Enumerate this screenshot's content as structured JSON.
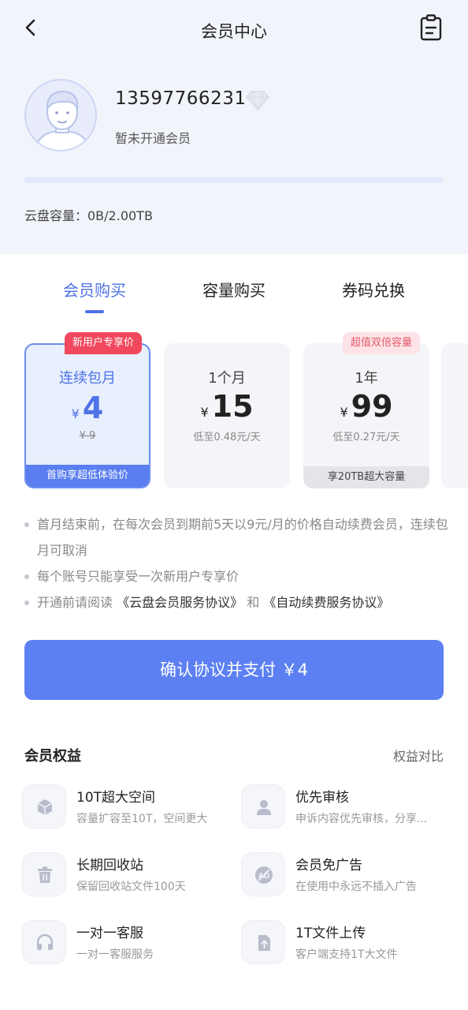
{
  "header": {
    "title": "会员中心"
  },
  "user": {
    "phone": "13597766231",
    "vip_status": "暂未开通会员",
    "capacity_text": "云盘容量：0B/2.00TB",
    "capacity_used_fraction": 0.0
  },
  "tabs": [
    {
      "label": "会员购买",
      "active": true
    },
    {
      "label": "容量购买",
      "active": false
    },
    {
      "label": "券码兑换",
      "active": false
    }
  ],
  "plans": [
    {
      "ribbon": "新用户专享价",
      "name": "连续包月",
      "currency": "¥",
      "price": "4",
      "sub": "¥ 9",
      "footer": "首购享超低体验价",
      "selected": true
    },
    {
      "ribbon": "",
      "name": "1个月",
      "currency": "¥",
      "price": "15",
      "sub": "低至0.48元/天",
      "footer": "",
      "selected": false
    },
    {
      "ribbon": "超值双倍容量",
      "name": "1年",
      "currency": "¥",
      "price": "99",
      "sub": "低至0.27元/天",
      "footer": "享20TB超大容量",
      "selected": false
    }
  ],
  "notes": {
    "note1": "首月结束前，在每次会员到期前5天以9元/月的价格自动续费会员，连续包月可取消",
    "note2": "每个账号只能享受一次新用户专享价",
    "note3_prefix": "开通前请阅读",
    "note3_link1": "《云盘会员服务协议》",
    "note3_and": "和",
    "note3_link2": "《自动续费服务协议》"
  },
  "pay_button": "确认协议并支付 ￥4",
  "benefits": {
    "title": "会员权益",
    "compare_label": "权益对比",
    "items": [
      {
        "name": "10T超大空间",
        "desc": "容量扩容至10T，空间更大",
        "icon": "box-icon"
      },
      {
        "name": "优先审核",
        "desc": "申诉内容优先审核，分享...",
        "icon": "person-icon"
      },
      {
        "name": "长期回收站",
        "desc": "保留回收站文件100天",
        "icon": "trash-icon"
      },
      {
        "name": "会员免广告",
        "desc": "在使用中永远不插入广告",
        "icon": "no-ad-icon"
      },
      {
        "name": "一对一客服",
        "desc": "一对一客服服务",
        "icon": "headset-icon"
      },
      {
        "name": "1T文件上传",
        "desc": "客户端支持1T大文件",
        "icon": "upload-file-icon"
      }
    ]
  },
  "colors": {
    "accent": "#4f72e6",
    "pay_button": "#5c80f2",
    "ribbon_red": "#f0485d",
    "ribbon_pink_bg": "#fde3e7"
  }
}
